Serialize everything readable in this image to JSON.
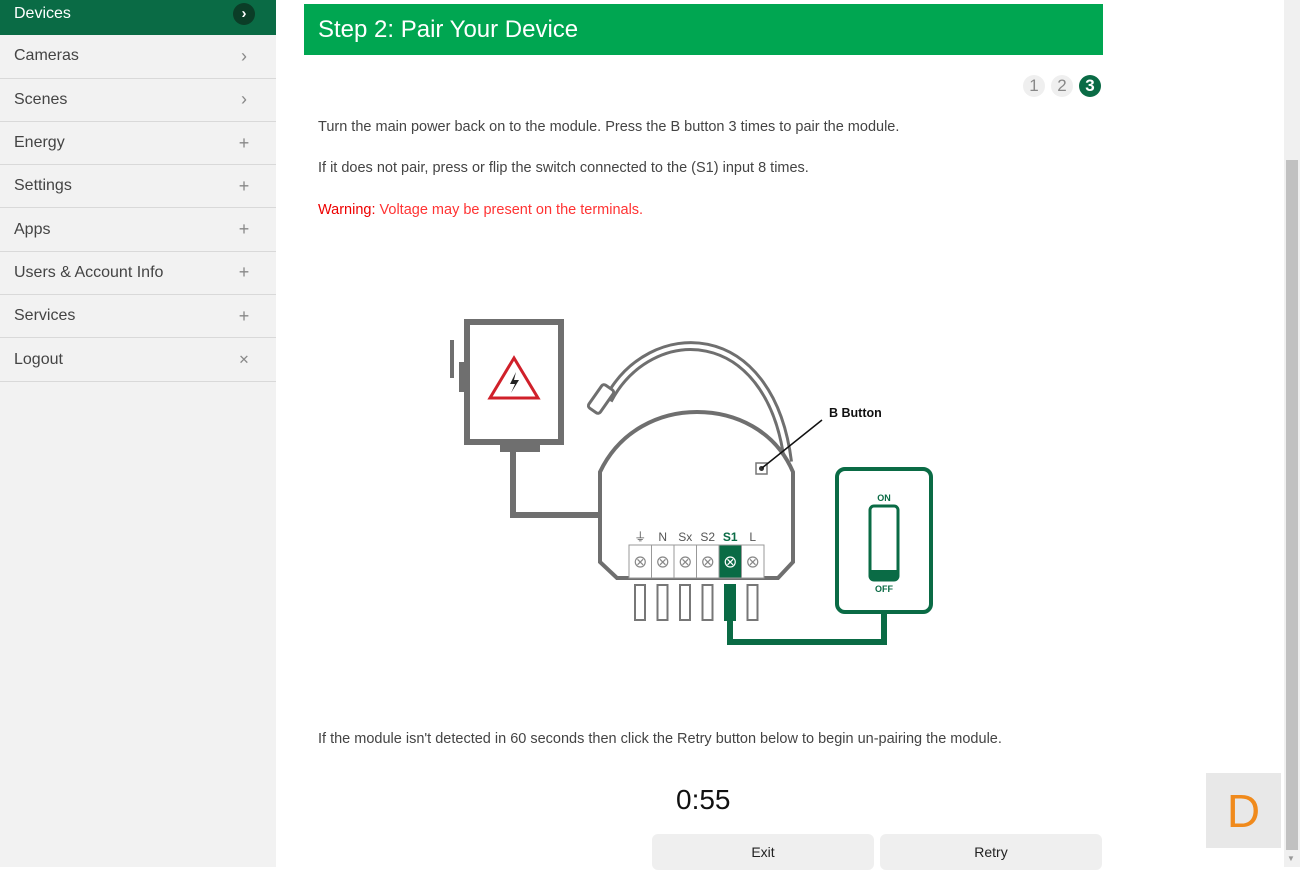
{
  "sidebar": {
    "items": [
      {
        "label": "Devices",
        "icon": "chevron-right",
        "glyph": "›"
      },
      {
        "label": "Cameras",
        "icon": "chevron-right",
        "glyph": "›"
      },
      {
        "label": "Scenes",
        "icon": "chevron-right",
        "glyph": "›"
      },
      {
        "label": "Energy",
        "icon": "plus",
        "glyph": "+"
      },
      {
        "label": "Settings",
        "icon": "plus",
        "glyph": "+"
      },
      {
        "label": "Apps",
        "icon": "plus",
        "glyph": "+"
      },
      {
        "label": "Users & Account Info",
        "icon": "plus",
        "glyph": "+"
      },
      {
        "label": "Services",
        "icon": "plus",
        "glyph": "+"
      },
      {
        "label": "Logout",
        "icon": "close",
        "glyph": "✕"
      }
    ]
  },
  "main": {
    "title": "Step 2: Pair Your Device",
    "steps": [
      "1",
      "2",
      "3"
    ],
    "instruction1": "Turn the main power back on to the module. Press the B button 3 times to pair the module.",
    "instruction2": "If it does not pair, press or flip the switch connected to the (S1) input 8 times.",
    "warning_label": "Warning:",
    "warning_text": " Voltage may be present on the terminals.",
    "diagram": {
      "b_button": "B Button",
      "terminals": [
        "⏚",
        "N",
        "Sx",
        "S2",
        "S1",
        "L"
      ],
      "on": "ON",
      "off": "OFF"
    },
    "retry_note": "If the module isn't detected in 60 seconds then click the Retry button below to begin un-pairing the module.",
    "timer": "0:55",
    "exit_label": "Exit",
    "retry_label": "Retry"
  },
  "widget": {
    "letter": "D"
  },
  "colors": {
    "green": "#00a651",
    "dark_green": "#0a6b45",
    "warning": "#e00000",
    "orange": "#f08a1c"
  }
}
